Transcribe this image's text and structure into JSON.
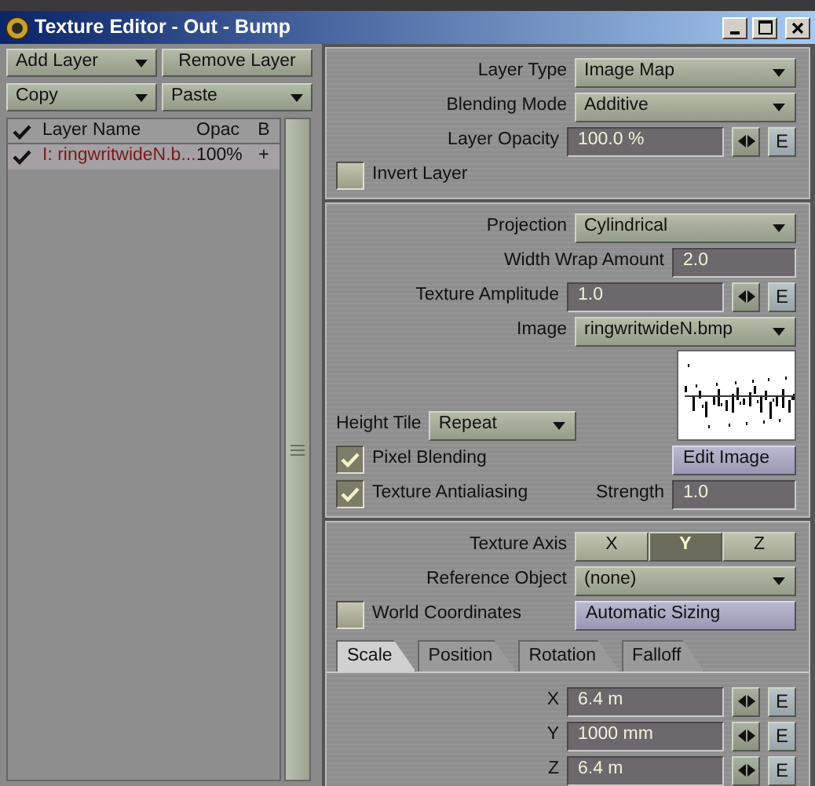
{
  "window": {
    "title": "Texture Editor - Out - Bump"
  },
  "layer_buttons": [
    {
      "label": "Add Layer",
      "kind": "dropdown"
    },
    {
      "label": "Remove Layer",
      "kind": "button"
    },
    {
      "label": "Copy",
      "kind": "dropdown"
    },
    {
      "label": "Paste",
      "kind": "dropdown"
    }
  ],
  "layer_list": {
    "columns": [
      "Layer Name",
      "Opac",
      "B"
    ],
    "rows": [
      {
        "enabled": true,
        "name": "I: ringwritwideN.b...",
        "opacity": "100%",
        "blend": "+"
      }
    ]
  },
  "layer_section": [
    {
      "kind": "dropdown",
      "label": "Layer Type",
      "value": "Image Map"
    },
    {
      "kind": "dropdown",
      "label": "Blending Mode",
      "value": "Additive"
    },
    {
      "kind": "envelope",
      "label": "Layer Opacity",
      "value": "100.0 %",
      "env": "E"
    },
    {
      "kind": "checkbox",
      "label": "Invert Layer",
      "checked": false
    }
  ],
  "image_section": {
    "rows": [
      {
        "kind": "dropdown",
        "label": "Projection",
        "value": "Cylindrical"
      },
      {
        "kind": "short_field",
        "label": "Width Wrap Amount",
        "value": "2.0"
      },
      {
        "kind": "envelope",
        "label": "Texture Amplitude",
        "value": "1.0",
        "env": "E"
      },
      {
        "kind": "dropdown",
        "label": "Image",
        "value": "ringwritwideN.bmp"
      }
    ],
    "height_tile": {
      "label": "Height Tile",
      "value": "Repeat"
    },
    "pixel_blending": {
      "label": "Pixel Blending",
      "checked": true
    },
    "edit_image": "Edit Image",
    "texture_antialiasing": {
      "label": "Texture Antialiasing",
      "checked": true
    },
    "strength": {
      "label": "Strength",
      "value": "1.0"
    }
  },
  "axis_section": {
    "texture_axis": {
      "label": "Texture Axis",
      "options": [
        {
          "label": "X",
          "selected": false
        },
        {
          "label": "Y",
          "selected": true
        },
        {
          "label": "Z",
          "selected": false
        }
      ]
    },
    "reference_object": {
      "label": "Reference Object",
      "value": "(none)"
    },
    "world_coordinates": {
      "label": "World Coordinates",
      "checked": false
    },
    "automatic_sizing": "Automatic Sizing",
    "tabs": [
      {
        "label": "Scale",
        "selected": true
      },
      {
        "label": "Position",
        "selected": false
      },
      {
        "label": "Rotation",
        "selected": false
      },
      {
        "label": "Falloff",
        "selected": false
      }
    ],
    "values": [
      {
        "label": "X",
        "value": "6.4 m",
        "env": "E"
      },
      {
        "label": "Y",
        "value": "1000 mm",
        "env": "E"
      },
      {
        "label": "Z",
        "value": "6.4 m",
        "env": "E"
      }
    ]
  }
}
